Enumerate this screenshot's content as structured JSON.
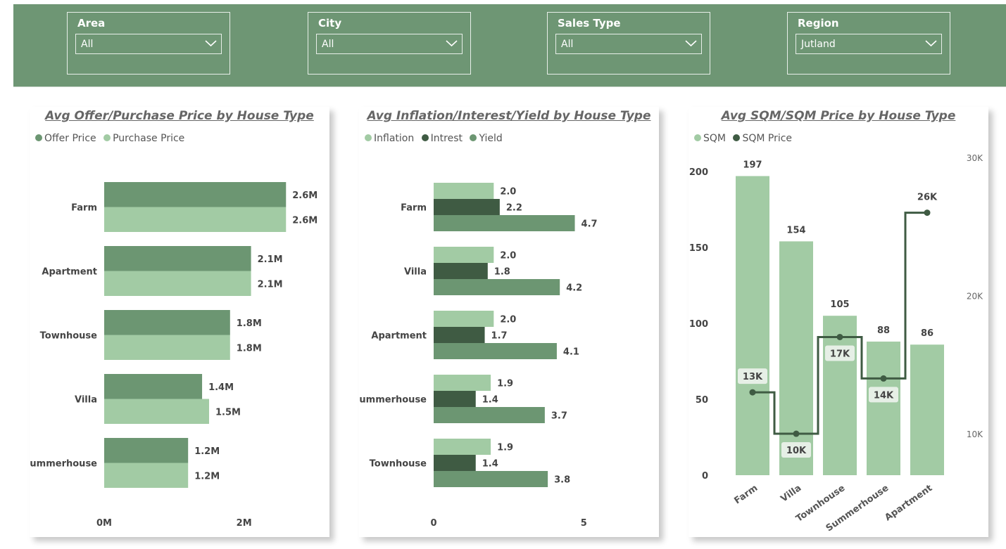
{
  "filters": [
    {
      "label": "Area",
      "value": "All"
    },
    {
      "label": "City",
      "value": "All"
    },
    {
      "label": "Sales Type",
      "value": "All"
    },
    {
      "label": "Region",
      "value": "Jutland"
    }
  ],
  "colors": {
    "light": "#a2cba4",
    "mid": "#6c9672",
    "dark": "#3f5b43",
    "filter_bg": "#6e9674"
  },
  "charts": {
    "price": {
      "title": "Avg Offer/Purchase Price by House Type",
      "legend": [
        {
          "label": "Offer Price",
          "color": "#6c9672"
        },
        {
          "label": "Purchase Price",
          "color": "#a2cba4"
        }
      ]
    },
    "rates": {
      "title": "Avg Inflation/Interest/Yield by House Type",
      "legend": [
        {
          "label": "Inflation",
          "color": "#a2cba4"
        },
        {
          "label": "Intrest",
          "color": "#3f5b43"
        },
        {
          "label": "Yield",
          "color": "#6c9672"
        }
      ]
    },
    "sqm": {
      "title": "Avg SQM/SQM Price by House Type",
      "legend": [
        {
          "label": "SQM",
          "color": "#a2cba4"
        },
        {
          "label": "SQM Price",
          "color": "#3f5b43"
        }
      ]
    }
  },
  "chart_data": [
    {
      "type": "bar",
      "orientation": "horizontal",
      "title": "Avg Offer/Purchase Price by House Type",
      "categories": [
        "Farm",
        "Apartment",
        "Townhouse",
        "Villa",
        "Summerhouse"
      ],
      "series": [
        {
          "name": "Offer Price",
          "values": [
            2.6,
            2.1,
            1.8,
            1.4,
            1.2
          ],
          "labels": [
            "2.6M",
            "2.1M",
            "1.8M",
            "1.4M",
            "1.2M"
          ],
          "color": "#6c9672"
        },
        {
          "name": "Purchase Price",
          "values": [
            2.6,
            2.1,
            1.8,
            1.5,
            1.2
          ],
          "labels": [
            "2.6M",
            "2.1M",
            "1.8M",
            "1.5M",
            "1.2M"
          ],
          "color": "#a2cba4"
        }
      ],
      "value_unit": "M",
      "xlim": [
        0,
        3.0
      ],
      "xticks": [
        {
          "value": 0,
          "label": "0M"
        },
        {
          "value": 2,
          "label": "2M"
        }
      ],
      "grid": false,
      "legend_position": "top-left"
    },
    {
      "type": "bar",
      "orientation": "horizontal",
      "title": "Avg Inflation/Interest/Yield by House Type",
      "categories": [
        "Farm",
        "Villa",
        "Apartment",
        "Summerhouse",
        "Townhouse"
      ],
      "series": [
        {
          "name": "Inflation",
          "values": [
            2.0,
            2.0,
            2.0,
            1.9,
            1.9
          ],
          "labels": [
            "2.0",
            "2.0",
            "2.0",
            "1.9",
            "1.9"
          ],
          "color": "#a2cba4"
        },
        {
          "name": "Intrest",
          "values": [
            2.2,
            1.8,
            1.7,
            1.4,
            1.4
          ],
          "labels": [
            "2.2",
            "1.8",
            "1.7",
            "1.4",
            "1.4"
          ],
          "color": "#3f5b43"
        },
        {
          "name": "Yield",
          "values": [
            4.7,
            4.2,
            4.1,
            3.7,
            3.8
          ],
          "labels": [
            "4.7",
            "4.2",
            "4.1",
            "3.7",
            "3.8"
          ],
          "color": "#6c9672"
        }
      ],
      "xlim": [
        0,
        6.0
      ],
      "xticks": [
        {
          "value": 0,
          "label": "0"
        },
        {
          "value": 5,
          "label": "5"
        }
      ],
      "grid": false,
      "legend_position": "top-left"
    },
    {
      "type": "bar",
      "combo": "bar+line",
      "title": "Avg SQM/SQM Price by House Type",
      "categories": [
        "Farm",
        "Villa",
        "Townhouse",
        "Summerhouse",
        "Apartment"
      ],
      "bars": {
        "name": "SQM",
        "values": [
          197,
          154,
          105,
          88,
          86
        ],
        "labels": [
          "197",
          "154",
          "105",
          "88",
          "86"
        ],
        "color": "#a2cba4"
      },
      "line": {
        "name": "SQM Price",
        "values": [
          13000,
          10000,
          17000,
          14000,
          26000
        ],
        "labels": [
          "13K",
          "10K",
          "17K",
          "14K",
          "26K"
        ],
        "color": "#3f5b43",
        "shape": "step"
      },
      "ylim_left": [
        0,
        200
      ],
      "yticks_left": [
        "0",
        "50",
        "100",
        "150",
        "200"
      ],
      "ylim_right": [
        7000,
        30000
      ],
      "yticks_right": [
        {
          "value": 10000,
          "label": "10K"
        },
        {
          "value": 20000,
          "label": "20K"
        },
        {
          "value": 30000,
          "label": "30K"
        }
      ],
      "grid": false,
      "legend_position": "top-left"
    }
  ]
}
